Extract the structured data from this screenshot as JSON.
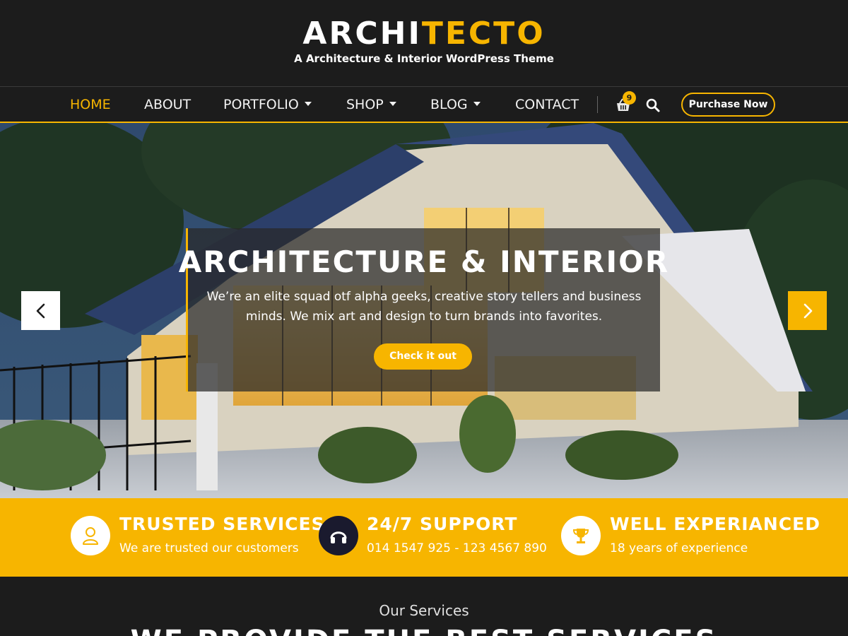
{
  "brand": {
    "logo_part1": "ARCHI",
    "logo_part2": "TECTO",
    "tagline": "A Architecture & Interior WordPress Theme",
    "accent_color": "#f7b500",
    "background_color": "#1c1c1c"
  },
  "nav": {
    "items": [
      {
        "label": "HOME",
        "active": true,
        "has_dropdown": false
      },
      {
        "label": "ABOUT",
        "active": false,
        "has_dropdown": false
      },
      {
        "label": "PORTFOLIO",
        "active": false,
        "has_dropdown": true
      },
      {
        "label": "SHOP",
        "active": false,
        "has_dropdown": true
      },
      {
        "label": "BLOG",
        "active": false,
        "has_dropdown": true
      },
      {
        "label": "CONTACT",
        "active": false,
        "has_dropdown": false
      }
    ],
    "cart_icon": "basket-icon",
    "cart_count": "9",
    "search_icon": "search-icon",
    "purchase_label": "Purchase Now"
  },
  "hero": {
    "title": "ARCHITECTURE & INTERIOR",
    "text": "We’re an elite squad otf alpha geeks, creative story tellers and business minds. We mix art and design to turn brands into favorites.",
    "cta_label": "Check it out",
    "prev_icon": "chevron-left-icon",
    "next_icon": "chevron-right-icon"
  },
  "features": [
    {
      "icon": "user-icon",
      "title": "TRUSTED SERVICES",
      "subtitle": "We are trusted our customers"
    },
    {
      "icon": "headset-icon",
      "title": "24/7 SUPPORT",
      "subtitle": "014 1547 925 - 123 4567 890"
    },
    {
      "icon": "trophy-icon",
      "title": "WELL EXPERIANCED",
      "subtitle": "18 years of experience"
    }
  ],
  "services": {
    "label": "Our Services",
    "heading": "WE PROVIDE THE BEST SERVICES"
  }
}
